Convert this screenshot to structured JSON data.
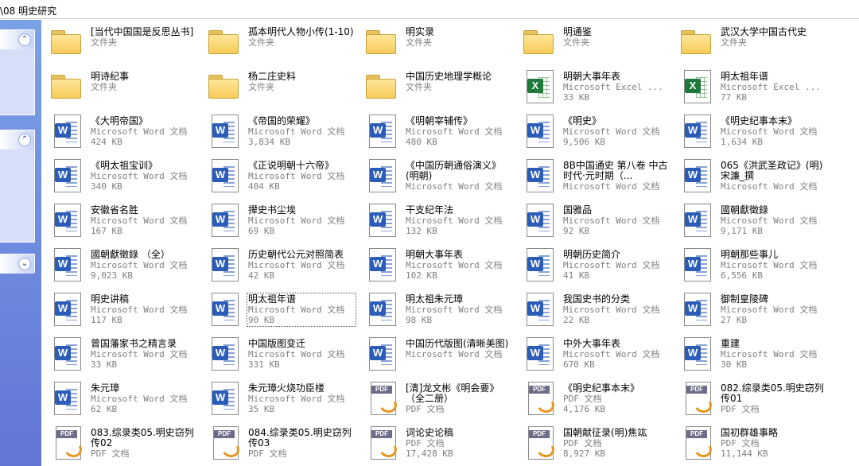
{
  "address": "\\08 明史研究",
  "sidebar": {
    "chevron_up": "⌃",
    "chevron_down": "⌄"
  },
  "items": [
    {
      "kind": "folder",
      "name": "[当代中国国是反思丛书]",
      "type": "文件夹",
      "size": "",
      "icon": "folder-icon"
    },
    {
      "kind": "folder",
      "name": "孤本明代人物小传(1-10)",
      "type": "文件夹",
      "size": "",
      "icon": "folder-icon"
    },
    {
      "kind": "folder",
      "name": "明实录",
      "type": "文件夹",
      "size": "",
      "icon": "folder-icon"
    },
    {
      "kind": "folder",
      "name": "明通鉴",
      "type": "文件夹",
      "size": "",
      "icon": "folder-icon"
    },
    {
      "kind": "folder",
      "name": "武汉大学中国古代史",
      "type": "文件夹",
      "size": "",
      "icon": "folder-icon"
    },
    {
      "kind": "folder",
      "name": "明诗纪事",
      "type": "文件夹",
      "size": "",
      "icon": "folder-icon"
    },
    {
      "kind": "folder",
      "name": "杨二庄史料",
      "type": "文件夹",
      "size": "",
      "icon": "folder-icon"
    },
    {
      "kind": "folder",
      "name": "中国历史地理学概论",
      "type": "文件夹",
      "size": "",
      "icon": "folder-icon"
    },
    {
      "kind": "excel",
      "name": "明朝大事年表",
      "type": "Microsoft Excel ...",
      "size": "33 KB",
      "icon": "excel-icon"
    },
    {
      "kind": "excel",
      "name": "明太祖年谱",
      "type": "Microsoft Excel ...",
      "size": "77 KB",
      "icon": "excel-icon"
    },
    {
      "kind": "word",
      "name": "《大明帝国》",
      "type": "Microsoft Word 文档",
      "size": "424 KB",
      "icon": "word-icon"
    },
    {
      "kind": "word",
      "name": "《帝国的荣耀》",
      "type": "Microsoft Word 文档",
      "size": "3,834 KB",
      "icon": "word-icon"
    },
    {
      "kind": "word",
      "name": "《明朝宰辅传》",
      "type": "Microsoft Word 文档",
      "size": "480 KB",
      "icon": "word-icon"
    },
    {
      "kind": "word",
      "name": "《明史》",
      "type": "Microsoft Word 文档",
      "size": "9,506 KB",
      "icon": "word-icon"
    },
    {
      "kind": "word",
      "name": "《明史纪事本末》",
      "type": "Microsoft Word 文档",
      "size": "1,634 KB",
      "icon": "word-icon"
    },
    {
      "kind": "word",
      "name": "《明太祖宝训》",
      "type": "Microsoft Word 文档",
      "size": "340 KB",
      "icon": "word-icon"
    },
    {
      "kind": "word",
      "name": "《正说明朝十六帝》",
      "type": "Microsoft Word 文档",
      "size": "404 KB",
      "icon": "word-icon"
    },
    {
      "kind": "word",
      "name": "《中国历朝通俗演义》(明朝)",
      "type": "Microsoft Word 文档",
      "size": "",
      "icon": "word-icon"
    },
    {
      "kind": "word",
      "name": "8B中国通史 第八卷 中古时代·元时期（...",
      "type": "Microsoft Word 文档",
      "size": "",
      "icon": "word-icon"
    },
    {
      "kind": "word",
      "name": "065《洪武圣政记》(明)宋濂_撰",
      "type": "Microsoft Word 文档",
      "size": "",
      "icon": "word-icon"
    },
    {
      "kind": "word",
      "name": "安徽省名胜",
      "type": "Microsoft Word 文档",
      "size": "167 KB",
      "icon": "word-icon"
    },
    {
      "kind": "word",
      "name": "撵史书尘埃",
      "type": "Microsoft Word 文档",
      "size": "69 KB",
      "icon": "word-icon"
    },
    {
      "kind": "word",
      "name": "干支纪年法",
      "type": "Microsoft Word 文档",
      "size": "132 KB",
      "icon": "word-icon"
    },
    {
      "kind": "word",
      "name": "国雅品",
      "type": "Microsoft Word 文档",
      "size": "92 KB",
      "icon": "word-icon"
    },
    {
      "kind": "word",
      "name": "國朝獻徵錄",
      "type": "Microsoft Word 文档",
      "size": "9,171 KB",
      "icon": "word-icon"
    },
    {
      "kind": "word",
      "name": "國朝獻徵錄 （全）",
      "type": "Microsoft Word 文档",
      "size": "9,023 KB",
      "icon": "word-icon"
    },
    {
      "kind": "word",
      "name": "历史朝代公元对照简表",
      "type": "Microsoft Word 文档",
      "size": "42 KB",
      "icon": "word-icon"
    },
    {
      "kind": "word",
      "name": "明朝大事年表",
      "type": "Microsoft Word 文档",
      "size": "102 KB",
      "icon": "word-icon"
    },
    {
      "kind": "word",
      "name": "明朝历史简介",
      "type": "Microsoft Word 文档",
      "size": "41 KB",
      "icon": "word-icon"
    },
    {
      "kind": "word",
      "name": "明朝那些事儿",
      "type": "Microsoft Word 文档",
      "size": "6,556 KB",
      "icon": "word-icon"
    },
    {
      "kind": "word",
      "name": "明史讲稿",
      "type": "Microsoft Word 文档",
      "size": "117 KB",
      "icon": "word-icon"
    },
    {
      "kind": "word",
      "name": "明太祖年谱",
      "type": "Microsoft Word 文档",
      "size": "90 KB",
      "icon": "word-icon",
      "selected": true
    },
    {
      "kind": "word",
      "name": "明太祖朱元璋",
      "type": "Microsoft Word 文档",
      "size": "98 KB",
      "icon": "word-icon"
    },
    {
      "kind": "word",
      "name": "我国史书的分类",
      "type": "Microsoft Word 文档",
      "size": "22 KB",
      "icon": "word-icon"
    },
    {
      "kind": "word",
      "name": "御制皇陵碑",
      "type": "Microsoft Word 文档",
      "size": "27 KB",
      "icon": "word-icon"
    },
    {
      "kind": "word",
      "name": "曾国藩家书之精言录",
      "type": "Microsoft Word 文档",
      "size": "33 KB",
      "icon": "word-icon"
    },
    {
      "kind": "word",
      "name": "中国版图变迁",
      "type": "Microsoft Word 文档",
      "size": "331 KB",
      "icon": "word-icon"
    },
    {
      "kind": "word",
      "name": "中国历代版图(清晰美图)",
      "type": "Microsoft Word 文档",
      "size": "",
      "icon": "word-icon"
    },
    {
      "kind": "word",
      "name": "中外大事年表",
      "type": "Microsoft Word 文档",
      "size": "670 KB",
      "icon": "word-icon"
    },
    {
      "kind": "word",
      "name": "重建",
      "type": "Microsoft Word 文档",
      "size": "30 KB",
      "icon": "word-icon"
    },
    {
      "kind": "word",
      "name": "朱元璋",
      "type": "Microsoft Word 文档",
      "size": "62 KB",
      "icon": "word-icon"
    },
    {
      "kind": "word",
      "name": "朱元璋火烧功臣楼",
      "type": "Microsoft Word 文档",
      "size": "35 KB",
      "icon": "word-icon"
    },
    {
      "kind": "pdf",
      "name": "[清]龙文彬《明会要》（全二册）",
      "type": "PDF 文档",
      "size": "",
      "icon": "pdf-icon"
    },
    {
      "kind": "pdf",
      "name": "《明史纪事本末》",
      "type": "PDF 文档",
      "size": "4,176 KB",
      "icon": "pdf-icon"
    },
    {
      "kind": "pdf",
      "name": "082.综录类05.明史窃列传01",
      "type": "PDF 文档",
      "size": "",
      "icon": "pdf-icon"
    },
    {
      "kind": "pdf",
      "name": "083.综录类05.明史窃列传02",
      "type": "PDF 文档",
      "size": "",
      "icon": "pdf-icon"
    },
    {
      "kind": "pdf",
      "name": "084.综录类05.明史窃列传03",
      "type": "PDF 文档",
      "size": "",
      "icon": "pdf-icon"
    },
    {
      "kind": "pdf",
      "name": "词论史论稿",
      "type": "PDF 文档",
      "size": "17,428 KB",
      "icon": "pdf-icon"
    },
    {
      "kind": "pdf",
      "name": "国朝献征录(明)焦竑",
      "type": "PDF 文档",
      "size": "8,927 KB",
      "icon": "pdf-icon"
    },
    {
      "kind": "pdf",
      "name": "国初群雄事略",
      "type": "PDF 文档",
      "size": "11,144 KB",
      "icon": "pdf-icon"
    }
  ]
}
